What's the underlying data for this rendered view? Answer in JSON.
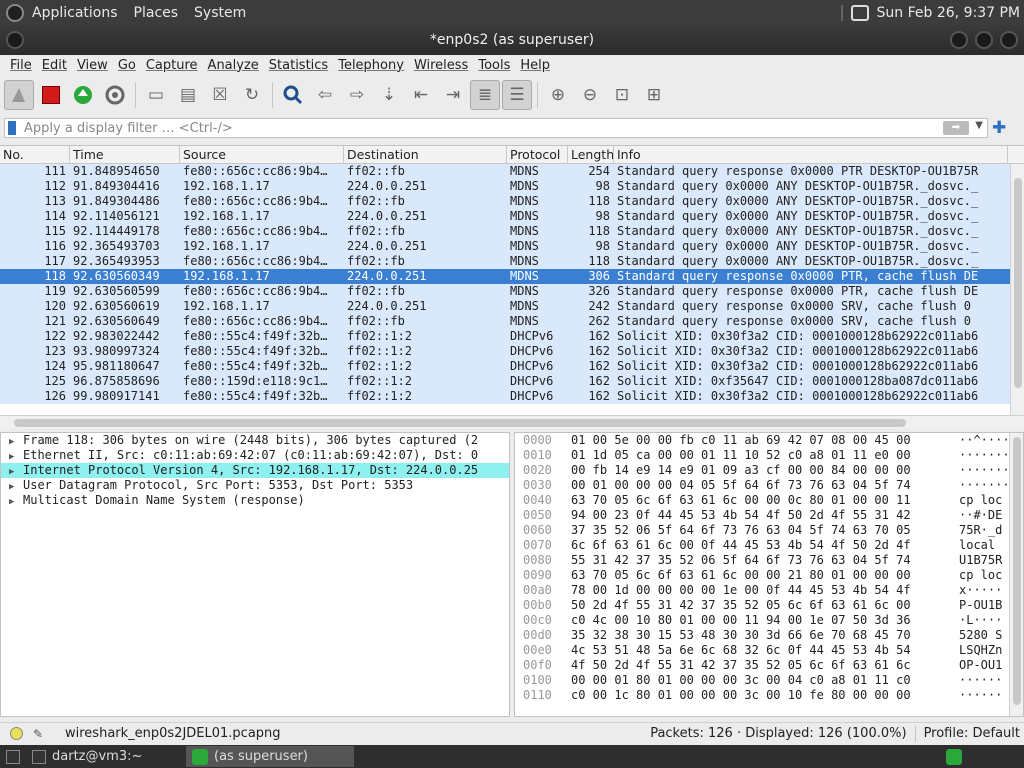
{
  "top_panel": {
    "menus": [
      "Applications",
      "Places",
      "System"
    ],
    "clock": "Sun Feb 26,  9:37 PM"
  },
  "window": {
    "title": "*enp0s2 (as superuser)"
  },
  "menu_bar": [
    "File",
    "Edit",
    "View",
    "Go",
    "Capture",
    "Analyze",
    "Statistics",
    "Telephony",
    "Wireless",
    "Tools",
    "Help"
  ],
  "filter": {
    "placeholder": "Apply a display filter … <Ctrl-/>"
  },
  "packet_list": {
    "columns": [
      "No.",
      "Time",
      "Source",
      "Destination",
      "Protocol",
      "Length",
      "Info"
    ],
    "rows": [
      {
        "no": "111",
        "time": "91.848954650",
        "src": "fe80::656c:cc86:9b4…",
        "dst": "ff02::fb",
        "proto": "MDNS",
        "len": "254",
        "info": "Standard query response 0x0000 PTR DESKTOP-OU1B75R"
      },
      {
        "no": "112",
        "time": "91.849304416",
        "src": "192.168.1.17",
        "dst": "224.0.0.251",
        "proto": "MDNS",
        "len": "98",
        "info": "Standard query 0x0000 ANY DESKTOP-OU1B75R._dosvc._"
      },
      {
        "no": "113",
        "time": "91.849304486",
        "src": "fe80::656c:cc86:9b4…",
        "dst": "ff02::fb",
        "proto": "MDNS",
        "len": "118",
        "info": "Standard query 0x0000 ANY DESKTOP-OU1B75R._dosvc._"
      },
      {
        "no": "114",
        "time": "92.114056121",
        "src": "192.168.1.17",
        "dst": "224.0.0.251",
        "proto": "MDNS",
        "len": "98",
        "info": "Standard query 0x0000 ANY DESKTOP-OU1B75R._dosvc._"
      },
      {
        "no": "115",
        "time": "92.114449178",
        "src": "fe80::656c:cc86:9b4…",
        "dst": "ff02::fb",
        "proto": "MDNS",
        "len": "118",
        "info": "Standard query 0x0000 ANY DESKTOP-OU1B75R._dosvc._"
      },
      {
        "no": "116",
        "time": "92.365493703",
        "src": "192.168.1.17",
        "dst": "224.0.0.251",
        "proto": "MDNS",
        "len": "98",
        "info": "Standard query 0x0000 ANY DESKTOP-OU1B75R._dosvc._"
      },
      {
        "no": "117",
        "time": "92.365493953",
        "src": "fe80::656c:cc86:9b4…",
        "dst": "ff02::fb",
        "proto": "MDNS",
        "len": "118",
        "info": "Standard query 0x0000 ANY DESKTOP-OU1B75R._dosvc._"
      },
      {
        "no": "118",
        "time": "92.630560349",
        "src": "192.168.1.17",
        "dst": "224.0.0.251",
        "proto": "MDNS",
        "len": "306",
        "info": "Standard query response 0x0000 PTR, cache flush DE",
        "selected": true
      },
      {
        "no": "119",
        "time": "92.630560599",
        "src": "fe80::656c:cc86:9b4…",
        "dst": "ff02::fb",
        "proto": "MDNS",
        "len": "326",
        "info": "Standard query response 0x0000 PTR, cache flush DE"
      },
      {
        "no": "120",
        "time": "92.630560619",
        "src": "192.168.1.17",
        "dst": "224.0.0.251",
        "proto": "MDNS",
        "len": "242",
        "info": "Standard query response 0x0000 SRV, cache flush 0"
      },
      {
        "no": "121",
        "time": "92.630560649",
        "src": "fe80::656c:cc86:9b4…",
        "dst": "ff02::fb",
        "proto": "MDNS",
        "len": "262",
        "info": "Standard query response 0x0000 SRV, cache flush 0"
      },
      {
        "no": "122",
        "time": "92.983022442",
        "src": "fe80::55c4:f49f:32b…",
        "dst": "ff02::1:2",
        "proto": "DHCPv6",
        "len": "162",
        "info": "Solicit XID: 0x30f3a2 CID: 0001000128b62922c011ab6"
      },
      {
        "no": "123",
        "time": "93.980997324",
        "src": "fe80::55c4:f49f:32b…",
        "dst": "ff02::1:2",
        "proto": "DHCPv6",
        "len": "162",
        "info": "Solicit XID: 0x30f3a2 CID: 0001000128b62922c011ab6"
      },
      {
        "no": "124",
        "time": "95.981180647",
        "src": "fe80::55c4:f49f:32b…",
        "dst": "ff02::1:2",
        "proto": "DHCPv6",
        "len": "162",
        "info": "Solicit XID: 0x30f3a2 CID: 0001000128b62922c011ab6"
      },
      {
        "no": "125",
        "time": "96.875858696",
        "src": "fe80::159d:e118:9c1…",
        "dst": "ff02::1:2",
        "proto": "DHCPv6",
        "len": "162",
        "info": "Solicit XID: 0xf35647 CID: 0001000128ba087dc011ab6"
      },
      {
        "no": "126",
        "time": "99.980917141",
        "src": "fe80::55c4:f49f:32b…",
        "dst": "ff02::1:2",
        "proto": "DHCPv6",
        "len": "162",
        "info": "Solicit XID: 0x30f3a2 CID: 0001000128b62922c011ab6"
      }
    ]
  },
  "details": [
    {
      "text": "Frame 118: 306 bytes on wire (2448 bits), 306 bytes captured (2",
      "highlight": false
    },
    {
      "text": "Ethernet II, Src: c0:11:ab:69:42:07 (c0:11:ab:69:42:07), Dst: 0",
      "highlight": false
    },
    {
      "text": "Internet Protocol Version 4, Src: 192.168.1.17, Dst: 224.0.0.25",
      "highlight": true
    },
    {
      "text": "User Datagram Protocol, Src Port: 5353, Dst Port: 5353",
      "highlight": false
    },
    {
      "text": "Multicast Domain Name System (response)",
      "highlight": false
    }
  ],
  "bytes": [
    {
      "off": "0000",
      "hex": "01 00 5e 00 00 fb c0 11  ab 69 42 07 08 00 45 00",
      "asc": "··^·····"
    },
    {
      "off": "0010",
      "hex": "01 1d 05 ca 00 00 01 11  10 52 c0 a8 01 11 e0 00",
      "asc": "········"
    },
    {
      "off": "0020",
      "hex": "00 fb 14 e9 14 e9 01 09  a3 cf 00 00 84 00 00 00",
      "asc": "········"
    },
    {
      "off": "0030",
      "hex": "00 01 00 00 00 04 05 5f  64 6f 73 76 63 04 5f 74",
      "asc": "········"
    },
    {
      "off": "0040",
      "hex": "63 70 05 6c 6f 63 61 6c  00 00 0c 80 01 00 00 11",
      "asc": "cp loc"
    },
    {
      "off": "0050",
      "hex": "94 00 23 0f 44 45 53 4b  54 4f 50 2d 4f 55 31 42",
      "asc": "··#·DE"
    },
    {
      "off": "0060",
      "hex": "37 35 52 06 5f 64 6f 73  76 63 04 5f 74 63 70 05",
      "asc": "75R·_d"
    },
    {
      "off": "0070",
      "hex": "6c 6f 63 61 6c 00 0f 44  45 53 4b 54 4f 50 2d 4f",
      "asc": "local"
    },
    {
      "off": "0080",
      "hex": "55 31 42 37 35 52 06 5f  64 6f 73 76 63 04 5f 74",
      "asc": "U1B75R"
    },
    {
      "off": "0090",
      "hex": "63 70 05 6c 6f 63 61 6c  00 00 21 80 01 00 00 00",
      "asc": "cp loc"
    },
    {
      "off": "00a0",
      "hex": "78 00 1d 00 00 00 00 1e  00 0f 44 45 53 4b 54 4f",
      "asc": "x·····"
    },
    {
      "off": "00b0",
      "hex": "50 2d 4f 55 31 42 37 35  52 05 6c 6f 63 61 6c 00",
      "asc": "P-OU1B"
    },
    {
      "off": "00c0",
      "hex": "c0 4c 00 10 80 01 00 00  11 94 00 1e 07 50 3d 36",
      "asc": "·L····"
    },
    {
      "off": "00d0",
      "hex": "35 32 38 30 15 53 48 30  30 3d 66 6e 70 68 45 70",
      "asc": "5280 S"
    },
    {
      "off": "00e0",
      "hex": "4c 53 51 48 5a 6e 6c 68  32 6c 0f 44 45 53 4b 54",
      "asc": "LSQHZn"
    },
    {
      "off": "00f0",
      "hex": "4f 50 2d 4f 55 31 42 37  35 52 05 6c 6f 63 61 6c",
      "asc": "OP-OU1"
    },
    {
      "off": "0100",
      "hex": "00 00 01 80 01 00 00 00  3c 00 04 c0 a8 01 11 c0",
      "asc": "······"
    },
    {
      "off": "0110",
      "hex": "c0 00 1c 80 01 00 00 00  3c 00 10 fe 80 00 00 00",
      "asc": "······"
    }
  ],
  "status": {
    "file": "wireshark_enp0s2JDEL01.pcapng",
    "packets": "Packets: 126 · Displayed: 126 (100.0%)",
    "profile": "Profile: Default"
  },
  "taskbar": {
    "terminal": "dartz@vm3:~",
    "app": "(as superuser)"
  },
  "colors": {
    "mdns_row": "#dae8fb",
    "selected_row": "#3a7fd2",
    "highlight": "#8ff0f0"
  },
  "icons": {
    "toolbar": [
      "shark-fin-start-icon",
      "stop-square-icon",
      "restart-icon",
      "options-gear-icon",
      "open-folder-icon",
      "save-file-icon",
      "close-file-icon",
      "reload-icon",
      "find-magnifier-icon",
      "go-back-icon",
      "go-forward-icon",
      "go-to-packet-icon",
      "first-packet-icon",
      "last-packet-icon",
      "autoscroll-icon",
      "colorize-icon",
      "zoom-in-icon",
      "zoom-out-icon",
      "normal-size-icon",
      "resize-columns-icon"
    ]
  }
}
